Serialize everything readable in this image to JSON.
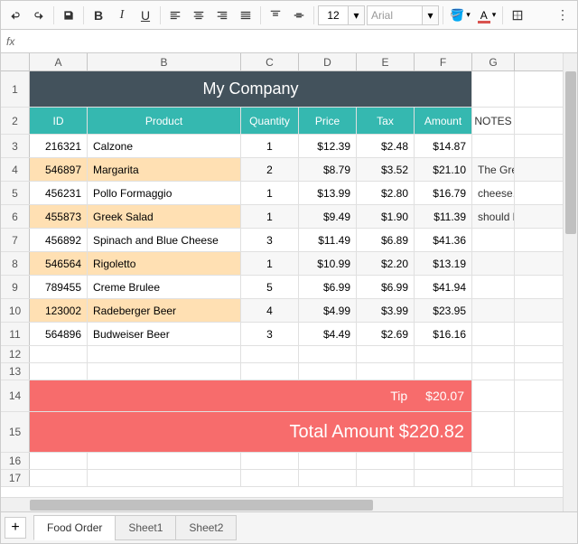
{
  "toolbar": {
    "font_size": "12",
    "font_name": "Arial"
  },
  "columns": [
    "A",
    "B",
    "C",
    "D",
    "E",
    "F",
    "G"
  ],
  "row_headers": [
    "1",
    "2",
    "3",
    "4",
    "5",
    "6",
    "7",
    "8",
    "9",
    "10",
    "11",
    "12",
    "13",
    "14",
    "15",
    "16",
    "17"
  ],
  "header": {
    "title": "My Company"
  },
  "table_headers": {
    "id": "ID",
    "product": "Product",
    "qty": "Quantity",
    "price": "Price",
    "tax": "Tax",
    "amount": "Amount",
    "notes": "NOTES"
  },
  "rows": [
    {
      "id": "216321",
      "product": "Calzone",
      "qty": "1",
      "price": "$12.39",
      "tax": "$2.48",
      "amount": "$14.87",
      "note": "",
      "hl": false
    },
    {
      "id": "546897",
      "product": "Margarita",
      "qty": "2",
      "price": "$8.79",
      "tax": "$3.52",
      "amount": "$21.10",
      "note": "The Greek S",
      "hl": true
    },
    {
      "id": "456231",
      "product": "Pollo Formaggio",
      "qty": "1",
      "price": "$13.99",
      "tax": "$2.80",
      "amount": "$16.79",
      "note": "cheese. One",
      "hl": false
    },
    {
      "id": "455873",
      "product": "Greek Salad",
      "qty": "1",
      "price": "$9.49",
      "tax": "$1.90",
      "amount": "$11.39",
      "note": "should be w",
      "hl": true
    },
    {
      "id": "456892",
      "product": "Spinach and Blue Cheese",
      "qty": "3",
      "price": "$11.49",
      "tax": "$6.89",
      "amount": "$41.36",
      "note": "",
      "hl": false
    },
    {
      "id": "546564",
      "product": "Rigoletto",
      "qty": "1",
      "price": "$10.99",
      "tax": "$2.20",
      "amount": "$13.19",
      "note": "",
      "hl": true
    },
    {
      "id": "789455",
      "product": "Creme Brulee",
      "qty": "5",
      "price": "$6.99",
      "tax": "$6.99",
      "amount": "$41.94",
      "note": "",
      "hl": false
    },
    {
      "id": "123002",
      "product": "Radeberger Beer",
      "qty": "4",
      "price": "$4.99",
      "tax": "$3.99",
      "amount": "$23.95",
      "note": "",
      "hl": true
    },
    {
      "id": "564896",
      "product": "Budweiser Beer",
      "qty": "3",
      "price": "$4.49",
      "tax": "$2.69",
      "amount": "$16.16",
      "note": "",
      "hl": false
    }
  ],
  "tip": {
    "label": "Tip",
    "value": "$20.07"
  },
  "total": {
    "label": "Total Amount",
    "value": "$220.82"
  },
  "sheets": [
    {
      "name": "Food Order",
      "active": true
    },
    {
      "name": "Sheet1",
      "active": false
    },
    {
      "name": "Sheet2",
      "active": false
    }
  ]
}
